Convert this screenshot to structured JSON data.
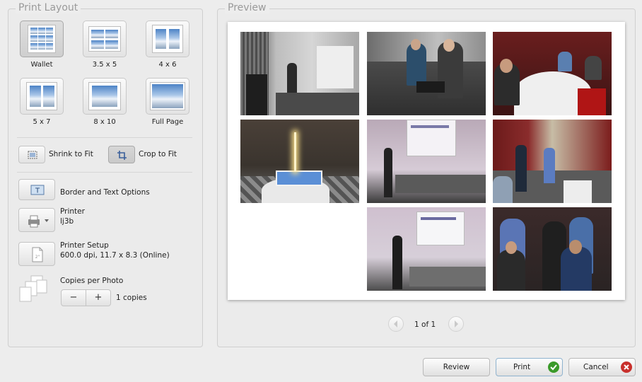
{
  "print_layout": {
    "title": "Print Layout",
    "layouts": [
      {
        "label": "Wallet",
        "selected": true
      },
      {
        "label": "3.5 x 5",
        "selected": false
      },
      {
        "label": "4 x 6",
        "selected": false
      },
      {
        "label": "5 x 7",
        "selected": false
      },
      {
        "label": "8 x 10",
        "selected": false
      },
      {
        "label": "Full Page",
        "selected": false
      }
    ],
    "fit": {
      "shrink_label": "Shrink to Fit",
      "crop_label": "Crop to Fit",
      "selected": "crop"
    },
    "border_text_label": "Border and Text Options",
    "printer": {
      "label": "Printer",
      "value": "lj3b"
    },
    "printer_setup": {
      "label": "Printer Setup",
      "value": "600.0 dpi, 11.7 x 8.3 (Online)"
    },
    "copies": {
      "label": "Copies per Photo",
      "decrement": "−",
      "increment": "+",
      "value_text": "1 copies"
    }
  },
  "preview": {
    "title": "Preview",
    "page_indicator": "1 of 1",
    "photos": [
      {
        "scene": "presenter-at-lectern"
      },
      {
        "scene": "two-men-with-laptops"
      },
      {
        "scene": "banquet-table"
      },
      {
        "scene": "birthday-cake-with-sparkler"
      },
      {
        "scene": "speaker-with-projector-screen"
      },
      {
        "scene": "speakers-in-red-hall"
      },
      {
        "scene": "speaker-at-screen"
      },
      {
        "scene": "group-conversation"
      }
    ]
  },
  "buttons": {
    "review": "Review",
    "print": "Print",
    "cancel": "Cancel"
  },
  "colors": {
    "accent_print": "#3a9a2a",
    "cancel_red": "#c8302c",
    "group_title": "#9a9a9a"
  }
}
